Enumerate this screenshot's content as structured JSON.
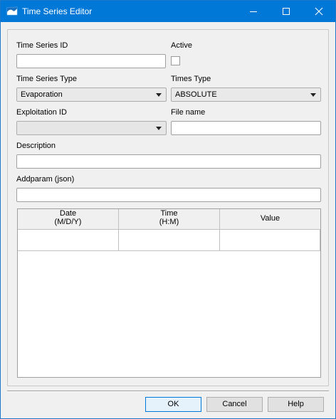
{
  "window": {
    "title": "Time Series Editor",
    "icon": "app-icon",
    "controls": [
      "minimize-icon",
      "maximize-icon",
      "close-icon"
    ]
  },
  "form": {
    "time_series_id": {
      "label": "Time Series ID",
      "value": ""
    },
    "active": {
      "label": "Active",
      "checked": false
    },
    "time_series_type": {
      "label": "Time Series Type",
      "value": "Evaporation"
    },
    "times_type": {
      "label": "Times Type",
      "value": "ABSOLUTE"
    },
    "exploitation_id": {
      "label": "Exploitation ID",
      "value": ""
    },
    "file_name": {
      "label": "File name",
      "value": ""
    },
    "description": {
      "label": "Description",
      "value": ""
    },
    "addparam": {
      "label": "Addparam (json)",
      "value": ""
    }
  },
  "table": {
    "columns": [
      {
        "line1": "Date",
        "line2": "(M/D/Y)"
      },
      {
        "line1": "Time",
        "line2": "(H:M)"
      },
      {
        "line1": "Value",
        "line2": ""
      }
    ],
    "rows": [
      [
        "",
        "",
        ""
      ]
    ]
  },
  "buttons": {
    "ok": "OK",
    "cancel": "Cancel",
    "help": "Help"
  },
  "colors": {
    "titlebar": "#0078d7",
    "background": "#f0f0f0"
  }
}
